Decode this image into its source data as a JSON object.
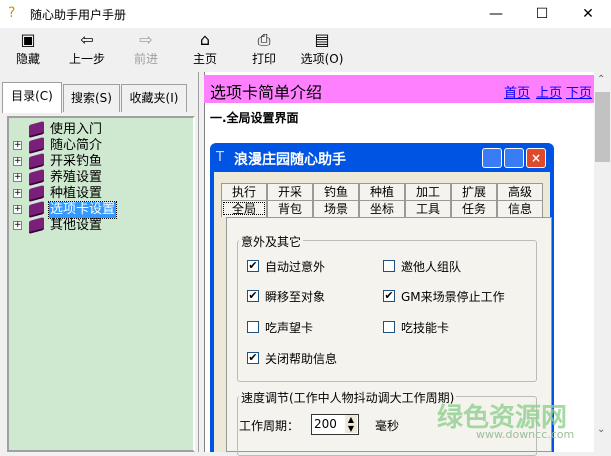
{
  "window": {
    "title": "随心助手用户手册",
    "minimize": "—",
    "maximize": "☐",
    "close": "✕"
  },
  "toolbar": [
    {
      "label": "隐藏",
      "icon": "▣"
    },
    {
      "label": "上一步",
      "icon": "⇦"
    },
    {
      "label": "前进",
      "icon": "⇨"
    },
    {
      "label": "主页",
      "icon": "⌂"
    },
    {
      "label": "打印",
      "icon": "⎙"
    },
    {
      "label": "选项(O)",
      "icon": "▤"
    }
  ],
  "left_tabs": [
    "目录(C)",
    "搜索(S)",
    "收藏夹(I)"
  ],
  "tree": [
    {
      "label": "使用入门",
      "expandable": false
    },
    {
      "label": "随心简介",
      "expandable": true
    },
    {
      "label": "开采钓鱼",
      "expandable": true
    },
    {
      "label": "养殖设置",
      "expandable": true
    },
    {
      "label": "种植设置",
      "expandable": true
    },
    {
      "label": "选项卡设置",
      "expandable": true,
      "selected": true
    },
    {
      "label": "其他设置",
      "expandable": true
    }
  ],
  "content": {
    "header": "选项卡简单介绍",
    "links": [
      "首页",
      "上页",
      "下页"
    ],
    "section": "一.全局设置界面"
  },
  "app": {
    "title": "浪漫庄园随心助手",
    "tabs_row1": [
      "执行",
      "开采",
      "钓鱼",
      "种植",
      "加工",
      "扩展",
      "高级"
    ],
    "tabs_row2": [
      "全局",
      "背包",
      "场景",
      "坐标",
      "工具",
      "任务",
      "信息"
    ],
    "group1": {
      "title": "意外及其它",
      "items": [
        {
          "label": "自动过意外",
          "checked": true
        },
        {
          "label": "邀他人组队",
          "checked": false
        },
        {
          "label": "瞬移至对象",
          "checked": true
        },
        {
          "label": "GM来场景停止工作",
          "checked": true
        },
        {
          "label": "吃声望卡",
          "checked": false
        },
        {
          "label": "吃技能卡",
          "checked": false
        },
        {
          "label": "关闭帮助信息",
          "checked": true
        }
      ]
    },
    "group2": {
      "title": "速度调节(工作中人物抖动调大工作周期)",
      "field_label": "工作周期：",
      "value": "200",
      "unit": "毫秒"
    }
  },
  "watermark": {
    "text": "绿色资源网",
    "url": "www.downcc.com"
  }
}
